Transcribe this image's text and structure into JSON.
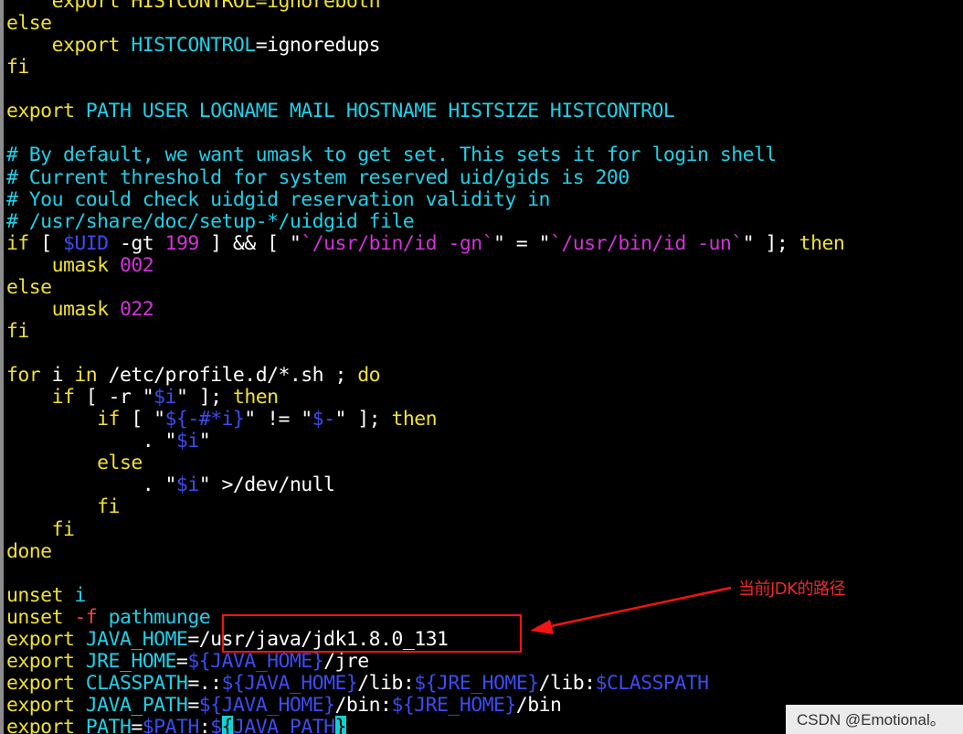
{
  "terminal": {
    "lines": [
      [
        {
          "t": "    export HISTCONTROL=ignoreboth",
          "c": "y"
        }
      ],
      [
        {
          "t": "else",
          "c": "y"
        }
      ],
      [
        {
          "t": "    export ",
          "c": "y"
        },
        {
          "t": "HISTCONTROL",
          "c": "c"
        },
        {
          "t": "=ignoredups",
          "c": "w"
        }
      ],
      [
        {
          "t": "fi",
          "c": "y"
        }
      ],
      [
        {
          "t": "",
          "c": "w"
        }
      ],
      [
        {
          "t": "export ",
          "c": "y"
        },
        {
          "t": "PATH USER LOGNAME MAIL HOSTNAME HISTSIZE HISTCONTROL",
          "c": "c"
        }
      ],
      [
        {
          "t": "",
          "c": "w"
        }
      ],
      [
        {
          "t": "# By default, we want umask to get set. This sets it for login shell",
          "c": "c"
        }
      ],
      [
        {
          "t": "# Current threshold for system reserved uid/gids is 200",
          "c": "c"
        }
      ],
      [
        {
          "t": "# You could check uidgid reservation validity in",
          "c": "c"
        }
      ],
      [
        {
          "t": "# /usr/share/doc/setup-*/uidgid file",
          "c": "c"
        }
      ],
      [
        {
          "t": "if",
          "c": "y"
        },
        {
          "t": " [ ",
          "c": "w"
        },
        {
          "t": "$UID",
          "c": "b"
        },
        {
          "t": " -gt ",
          "c": "w"
        },
        {
          "t": "199",
          "c": "m"
        },
        {
          "t": " ] && [ \"",
          "c": "w"
        },
        {
          "t": "`/usr/bin/id -gn`",
          "c": "m"
        },
        {
          "t": "\" = \"",
          "c": "w"
        },
        {
          "t": "`/usr/bin/id -un`",
          "c": "m"
        },
        {
          "t": "\" ]; ",
          "c": "w"
        },
        {
          "t": "then",
          "c": "y"
        }
      ],
      [
        {
          "t": "    umask ",
          "c": "y"
        },
        {
          "t": "002",
          "c": "m"
        }
      ],
      [
        {
          "t": "else",
          "c": "y"
        }
      ],
      [
        {
          "t": "    umask ",
          "c": "y"
        },
        {
          "t": "022",
          "c": "m"
        }
      ],
      [
        {
          "t": "fi",
          "c": "y"
        }
      ],
      [
        {
          "t": "",
          "c": "w"
        }
      ],
      [
        {
          "t": "for",
          "c": "y"
        },
        {
          "t": " i ",
          "c": "w"
        },
        {
          "t": "in",
          "c": "y"
        },
        {
          "t": " /etc/profile.d/*.sh ; ",
          "c": "w"
        },
        {
          "t": "do",
          "c": "y"
        }
      ],
      [
        {
          "t": "    if",
          "c": "y"
        },
        {
          "t": " [ -r \"",
          "c": "w"
        },
        {
          "t": "$i",
          "c": "b"
        },
        {
          "t": "\" ]; ",
          "c": "w"
        },
        {
          "t": "then",
          "c": "y"
        }
      ],
      [
        {
          "t": "        if",
          "c": "y"
        },
        {
          "t": " [ \"",
          "c": "w"
        },
        {
          "t": "${-#*i}",
          "c": "b"
        },
        {
          "t": "\" != \"",
          "c": "w"
        },
        {
          "t": "$-",
          "c": "b"
        },
        {
          "t": "\" ]; ",
          "c": "w"
        },
        {
          "t": "then",
          "c": "y"
        }
      ],
      [
        {
          "t": "            . \"",
          "c": "w"
        },
        {
          "t": "$i",
          "c": "b"
        },
        {
          "t": "\"",
          "c": "w"
        }
      ],
      [
        {
          "t": "        else",
          "c": "y"
        }
      ],
      [
        {
          "t": "            . \"",
          "c": "w"
        },
        {
          "t": "$i",
          "c": "b"
        },
        {
          "t": "\" >/dev/null",
          "c": "w"
        }
      ],
      [
        {
          "t": "        fi",
          "c": "y"
        }
      ],
      [
        {
          "t": "    fi",
          "c": "y"
        }
      ],
      [
        {
          "t": "done",
          "c": "y"
        }
      ],
      [
        {
          "t": "",
          "c": "w"
        }
      ],
      [
        {
          "t": "unset",
          "c": "y"
        },
        {
          "t": " i",
          "c": "c"
        }
      ],
      [
        {
          "t": "unset",
          "c": "y"
        },
        {
          "t": " -f ",
          "c": "r"
        },
        {
          "t": "pathmunge",
          "c": "c"
        }
      ],
      [
        {
          "t": "export ",
          "c": "y"
        },
        {
          "t": "JAVA_HOME",
          "c": "c"
        },
        {
          "t": "=/usr/java/jdk1.8.0_131",
          "c": "w"
        }
      ],
      [
        {
          "t": "export ",
          "c": "y"
        },
        {
          "t": "JRE_HOME",
          "c": "c"
        },
        {
          "t": "=",
          "c": "w"
        },
        {
          "t": "${JAVA_HOME}",
          "c": "b"
        },
        {
          "t": "/jre",
          "c": "w"
        }
      ],
      [
        {
          "t": "export ",
          "c": "y"
        },
        {
          "t": "CLASSPATH",
          "c": "c"
        },
        {
          "t": "=.:",
          "c": "w"
        },
        {
          "t": "${JAVA_HOME}",
          "c": "b"
        },
        {
          "t": "/lib:",
          "c": "w"
        },
        {
          "t": "${JRE_HOME}",
          "c": "b"
        },
        {
          "t": "/lib:",
          "c": "w"
        },
        {
          "t": "$CLASSPATH",
          "c": "b"
        }
      ],
      [
        {
          "t": "export ",
          "c": "y"
        },
        {
          "t": "JAVA_PATH",
          "c": "c"
        },
        {
          "t": "=",
          "c": "w"
        },
        {
          "t": "${JAVA_HOME}",
          "c": "b"
        },
        {
          "t": "/bin:",
          "c": "w"
        },
        {
          "t": "${JRE_HOME}",
          "c": "b"
        },
        {
          "t": "/bin",
          "c": "w"
        }
      ],
      [
        {
          "t": "export ",
          "c": "y"
        },
        {
          "t": "PATH",
          "c": "c"
        },
        {
          "t": "=",
          "c": "w"
        },
        {
          "t": "$PATH",
          "c": "b"
        },
        {
          "t": ":",
          "c": "w"
        },
        {
          "t": "$",
          "c": "b"
        },
        {
          "t": "{",
          "c": "cur"
        },
        {
          "t": "JAVA_PATH",
          "c": "b"
        },
        {
          "t": "}",
          "c": "cur"
        }
      ]
    ]
  },
  "annotation": {
    "label": "当前JDK的路径",
    "color": "#f02828"
  },
  "watermark": {
    "text": "CSDN @Emotional。"
  },
  "colors": {
    "background": "#000000",
    "keyword": "#f0e130",
    "variable": "#1fd0e8",
    "number": "#d332d8",
    "expansion": "#3c4cf0",
    "option": "#f04040",
    "cursor": "#0bd4d4"
  }
}
